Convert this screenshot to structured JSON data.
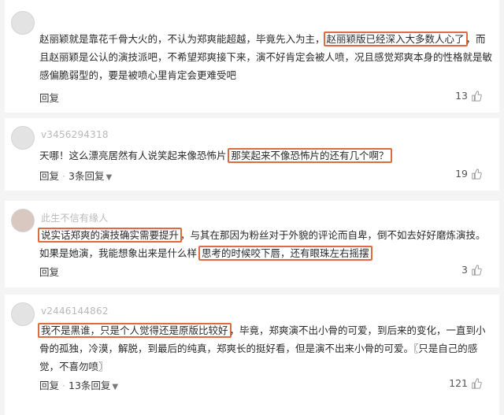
{
  "comments": [
    {
      "username": "",
      "text_parts": [
        "赵丽颖就是靠花千骨大火的，不认为郑爽能超越，毕竟先入为主，",
        "赵丽颖版已经深入大多数人心了",
        "，而且赵丽颖是公认的演技派吧，不希望郑爽接下来，演不好肯定会被人喷，况且感觉郑爽本身的性格就是敏感偏脆弱型的，要是被喷心里肯定会更难受吧"
      ],
      "reply_label": "回复",
      "reply_count": "",
      "likes": "13"
    },
    {
      "username": "v3456294318",
      "text_parts": [
        "天哪！这么漂亮居然有人说笑起来像恐怖片 ",
        "那笑起来不像恐怖片的还有几个啊？",
        ""
      ],
      "reply_label": "回复",
      "reply_count": "3条回复",
      "likes": "19"
    },
    {
      "username": "此生不信有缘人",
      "text_parts": [
        "说实话郑爽的演技确实需要提升",
        "，与其在那因为粉丝对于外貌的评论而自卑，倒不如去好好磨炼演技。如果是她演，我能想象出来是什么样 ",
        "思考的时候咬下唇，还有眼珠左右摇摆"
      ],
      "reply_label": "回复",
      "reply_count": "",
      "likes": "3"
    },
    {
      "username": "v2446144862",
      "text_parts": [
        "我不是黑谁，只是个人觉得还是原版比较好",
        "，毕竟，郑爽演不出小骨的可爱，到后来的变化，一直到小骨的孤独，冷漠，解脱，到最后的纯真，郑爽长的挺好看，但是演不出来小骨的可爱。",
        "〖只是自己的感觉，不喜勿喷〗"
      ],
      "reply_label": "回复",
      "reply_count": "13条回复",
      "likes": "121"
    }
  ],
  "colors": {
    "highlight": "#e06b3e",
    "username": "#b9b9b9",
    "text": "#2a2a2a"
  },
  "icons": {
    "like": "thumb-up-icon",
    "expand": "chevron-down-icon"
  }
}
